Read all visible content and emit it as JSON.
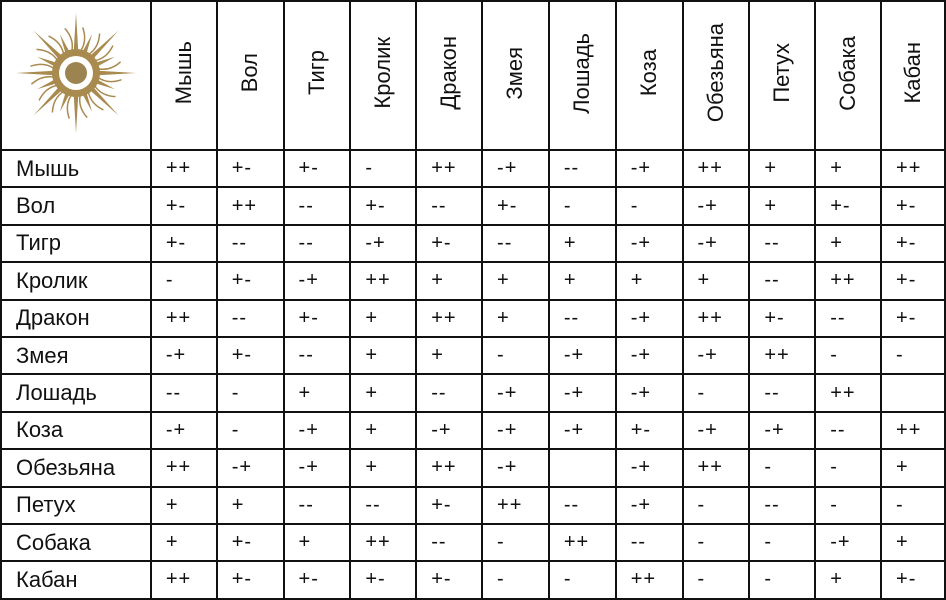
{
  "colors": {
    "logo": "#a98a4f",
    "border": "#111111"
  },
  "logo": {
    "icon": "sun-icon"
  },
  "columns": [
    "Мышь",
    "Вол",
    "Тигр",
    "Кролик",
    "Дракон",
    "Змея",
    "Лошадь",
    "Коза",
    "Обезьяна",
    "Петух",
    "Собака",
    "Кабан"
  ],
  "rows": [
    {
      "label": "Мышь",
      "cells": [
        "++",
        "+-",
        "+-",
        "-",
        "++",
        "-+",
        "--",
        "-+",
        "++",
        "+",
        "+",
        "++"
      ]
    },
    {
      "label": "Вол",
      "cells": [
        "+-",
        "++",
        "--",
        "+-",
        "--",
        "+-",
        "-",
        "-",
        "-+",
        "+",
        "+-",
        "+-"
      ]
    },
    {
      "label": "Тигр",
      "cells": [
        "+-",
        "--",
        "--",
        "-+",
        "+-",
        "--",
        "+",
        "-+",
        "-+",
        "--",
        "+",
        "+-"
      ]
    },
    {
      "label": "Кролик",
      "cells": [
        "-",
        "+-",
        "-+",
        "++",
        "+",
        "+",
        "+",
        "+",
        "+",
        "--",
        "++",
        "+-"
      ]
    },
    {
      "label": "Дракон",
      "cells": [
        "++",
        "--",
        "+-",
        "+",
        "++",
        "+",
        "--",
        "-+",
        "++",
        "+-",
        "--",
        "+-"
      ]
    },
    {
      "label": "Змея",
      "cells": [
        "-+",
        "+-",
        "--",
        "+",
        "+",
        "-",
        "-+",
        "-+",
        "-+",
        "++",
        "-",
        "-"
      ]
    },
    {
      "label": "Лошадь",
      "cells": [
        "--",
        "-",
        "+",
        "+",
        "--",
        "-+",
        "-+",
        "-+",
        "-",
        "--",
        "++",
        ""
      ]
    },
    {
      "label": "Коза",
      "cells": [
        "-+",
        "-",
        "-+",
        "+",
        "-+",
        "-+",
        "-+",
        "+-",
        "-+",
        "-+",
        "--",
        "++"
      ]
    },
    {
      "label": "Обезьяна",
      "cells": [
        "++",
        "-+",
        "-+",
        "+",
        "++",
        "-+",
        "",
        "-+",
        "++",
        "-",
        "-",
        "+"
      ]
    },
    {
      "label": "Петух",
      "cells": [
        "+",
        "+",
        "--",
        "--",
        "+-",
        "++",
        "--",
        "-+",
        "-",
        "--",
        "-",
        "-"
      ]
    },
    {
      "label": "Собака",
      "cells": [
        "+",
        "+-",
        "+",
        "++",
        "--",
        "-",
        "++",
        "--",
        "-",
        "-",
        "-+",
        "+"
      ]
    },
    {
      "label": "Кабан",
      "cells": [
        "++",
        "+-",
        "+-",
        "+-",
        "+-",
        "-",
        "-",
        "++",
        "-",
        "-",
        "+",
        "+-"
      ]
    }
  ]
}
